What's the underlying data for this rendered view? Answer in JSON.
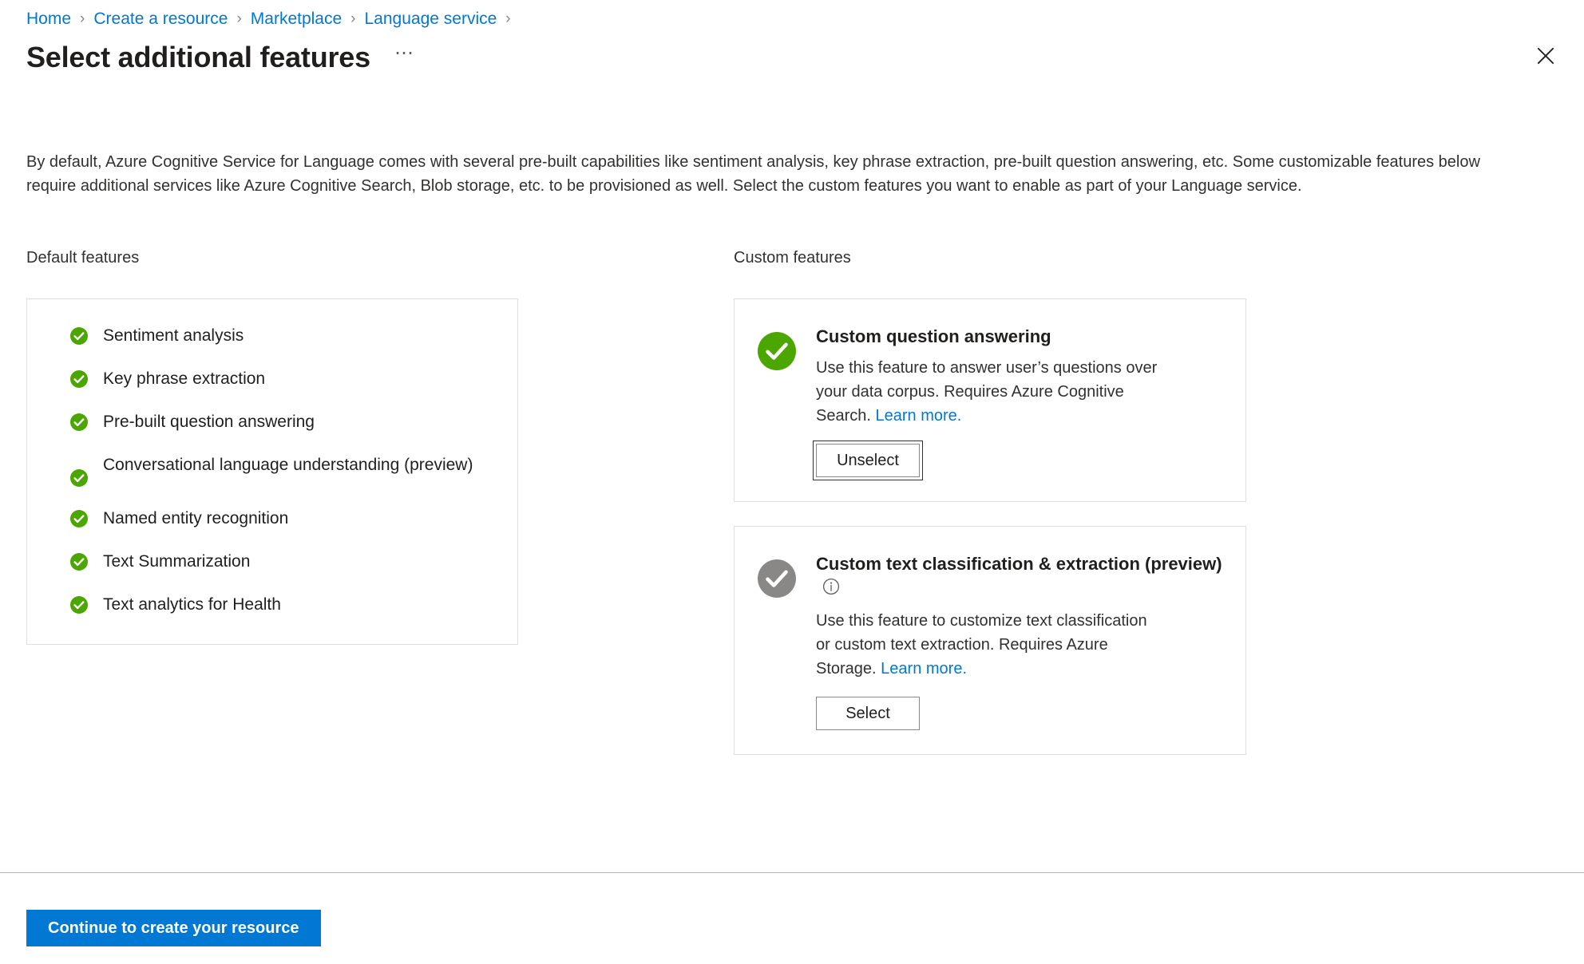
{
  "breadcrumb": {
    "items": [
      {
        "label": "Home"
      },
      {
        "label": "Create a resource"
      },
      {
        "label": "Marketplace"
      },
      {
        "label": "Language service"
      }
    ],
    "separator": "›"
  },
  "header": {
    "title": "Select additional features",
    "more_menu": "⋯",
    "close_icon": "close-icon"
  },
  "description": "By default, Azure Cognitive Service for Language comes with several pre-built capabilities like sentiment analysis, key phrase extraction, pre-built question answering, etc. Some customizable features below require additional services like Azure Cognitive Search, Blob storage, etc. to be provisioned as well. Select the custom features you want to enable as part of your Language service.",
  "default_features": {
    "heading": "Default features",
    "items": [
      {
        "label": "Sentiment analysis",
        "state": "enabled"
      },
      {
        "label": "Key phrase extraction",
        "state": "enabled"
      },
      {
        "label": "Pre-built question answering",
        "state": "enabled"
      },
      {
        "label": "Conversational language understanding (preview)",
        "state": "enabled"
      },
      {
        "label": "Named entity recognition",
        "state": "enabled"
      },
      {
        "label": "Text Summarization",
        "state": "enabled"
      },
      {
        "label": "Text analytics for Health",
        "state": "enabled"
      }
    ]
  },
  "custom_features": {
    "heading": "Custom features",
    "cards": [
      {
        "title": "Custom question answering",
        "preview_suffix": "",
        "has_info_icon": false,
        "description": "Use this feature to answer user’s questions over your data corpus. Requires Azure Cognitive Search. ",
        "learn_more": "Learn more.",
        "button_label": "Unselect",
        "selected": true,
        "focused": true,
        "icon_color": "#4ca600"
      },
      {
        "title": "Custom text classification & extraction (preview)",
        "preview_suffix": "",
        "has_info_icon": true,
        "description": "Use this feature to customize text classification or custom text extraction. Requires Azure Storage. ",
        "learn_more": "Learn more.",
        "button_label": "Select",
        "selected": false,
        "focused": false,
        "icon_color": "#8a8886"
      }
    ]
  },
  "footer": {
    "primary_button": "Continue to create your resource"
  },
  "colors": {
    "accent": "#0078d4",
    "success": "#4ca600",
    "neutral": "#8a8886",
    "border": "#e1dfdd",
    "text": "#323130"
  }
}
